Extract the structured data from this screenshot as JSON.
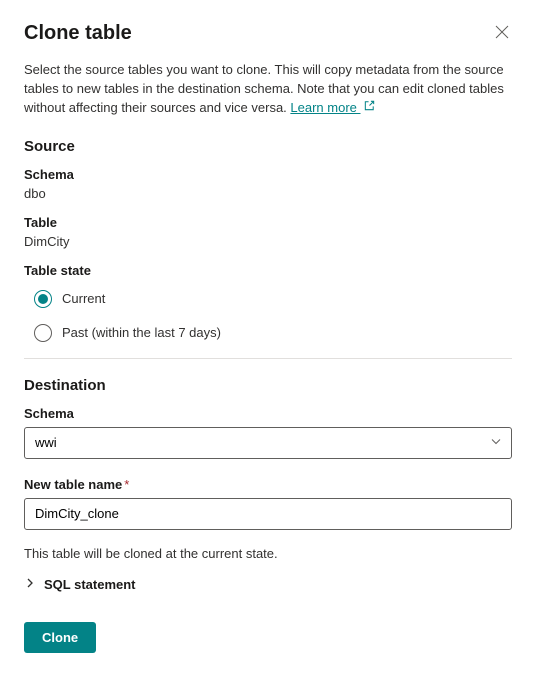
{
  "dialog": {
    "title": "Clone table",
    "description": "Select the source tables you want to clone. This will copy metadata from the source tables to new tables in the destination schema. Note that you can edit cloned tables without affecting their sources and vice versa. ",
    "learn_more": "Learn more "
  },
  "source": {
    "heading": "Source",
    "schema_label": "Schema",
    "schema_value": "dbo",
    "table_label": "Table",
    "table_value": "DimCity",
    "state_label": "Table state",
    "radio_current": "Current",
    "radio_past": "Past (within the last 7 days)"
  },
  "destination": {
    "heading": "Destination",
    "schema_label": "Schema",
    "schema_value": "wwi",
    "table_name_label": "New table name",
    "table_name_value": "DimCity_clone"
  },
  "footer": {
    "note": "This table will be cloned at the current state.",
    "sql_label": "SQL statement",
    "clone_button": "Clone"
  }
}
